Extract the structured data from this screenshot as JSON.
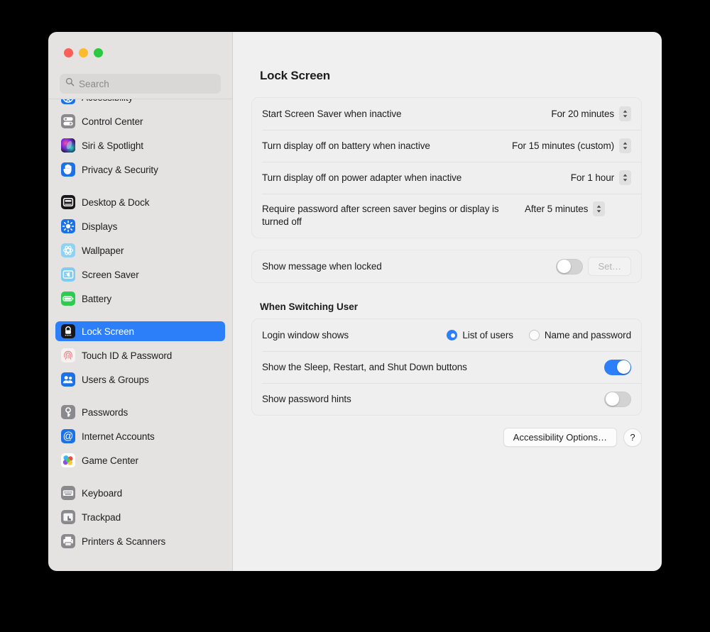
{
  "window": {
    "traffic_lights": [
      {
        "name": "close",
        "color": "#FB5F57"
      },
      {
        "name": "minimize",
        "color": "#FCBB2F"
      },
      {
        "name": "zoom",
        "color": "#2BC840"
      }
    ]
  },
  "search": {
    "placeholder": "Search",
    "value": ""
  },
  "sidebar": {
    "groups": [
      {
        "items": [
          {
            "label": "Accessibility",
            "icon": "accessibility-icon",
            "selected": false,
            "partial": true
          },
          {
            "label": "Control Center",
            "icon": "control-center-icon",
            "selected": false
          },
          {
            "label": "Siri & Spotlight",
            "icon": "siri-icon",
            "selected": false
          },
          {
            "label": "Privacy & Security",
            "icon": "privacy-security-icon",
            "selected": false
          }
        ]
      },
      {
        "items": [
          {
            "label": "Desktop & Dock",
            "icon": "desktop-dock-icon",
            "selected": false
          },
          {
            "label": "Displays",
            "icon": "displays-icon",
            "selected": false
          },
          {
            "label": "Wallpaper",
            "icon": "wallpaper-icon",
            "selected": false
          },
          {
            "label": "Screen Saver",
            "icon": "screen-saver-icon",
            "selected": false
          },
          {
            "label": "Battery",
            "icon": "battery-icon",
            "selected": false
          }
        ]
      },
      {
        "items": [
          {
            "label": "Lock Screen",
            "icon": "lock-screen-icon",
            "selected": true
          },
          {
            "label": "Touch ID & Password",
            "icon": "touch-id-icon",
            "selected": false
          },
          {
            "label": "Users & Groups",
            "icon": "users-groups-icon",
            "selected": false
          }
        ]
      },
      {
        "items": [
          {
            "label": "Passwords",
            "icon": "passwords-icon",
            "selected": false
          },
          {
            "label": "Internet Accounts",
            "icon": "internet-accounts-icon",
            "selected": false
          },
          {
            "label": "Game Center",
            "icon": "game-center-icon",
            "selected": false
          }
        ]
      },
      {
        "items": [
          {
            "label": "Keyboard",
            "icon": "keyboard-icon",
            "selected": false
          },
          {
            "label": "Trackpad",
            "icon": "trackpad-icon",
            "selected": false
          },
          {
            "label": "Printers & Scanners",
            "icon": "printers-scanners-icon",
            "selected": false
          }
        ]
      }
    ]
  },
  "main": {
    "title": "Lock Screen",
    "card1": {
      "rows": [
        {
          "label": "Start Screen Saver when inactive",
          "value": "For 20 minutes"
        },
        {
          "label": "Turn display off on battery when inactive",
          "value": "For 15 minutes (custom)"
        },
        {
          "label": "Turn display off on power adapter when inactive",
          "value": "For 1 hour"
        },
        {
          "label": "Require password after screen saver begins or display is turned off",
          "value": "After 5 minutes"
        }
      ]
    },
    "card2": {
      "message_label": "Show message when locked",
      "message_toggle_on": false,
      "set_button": "Set…",
      "set_button_disabled": true
    },
    "switching_user": {
      "section_title": "When Switching User",
      "login_window_label": "Login window shows",
      "options": [
        {
          "label": "List of users",
          "selected": true
        },
        {
          "label": "Name and password",
          "selected": false
        }
      ],
      "sleep_restart_label": "Show the Sleep, Restart, and Shut Down buttons",
      "sleep_restart_on": true,
      "password_hints_label": "Show password hints",
      "password_hints_on": false
    },
    "footer": {
      "accessibility_options": "Accessibility Options…",
      "help": "?"
    }
  },
  "colors": {
    "accent": "#2D7FF9",
    "sidebar_bg": "#E4E3E2",
    "pane_bg": "#F0F0F0",
    "card_bg": "#EFEFEF",
    "desktop_bg": "#000000"
  }
}
